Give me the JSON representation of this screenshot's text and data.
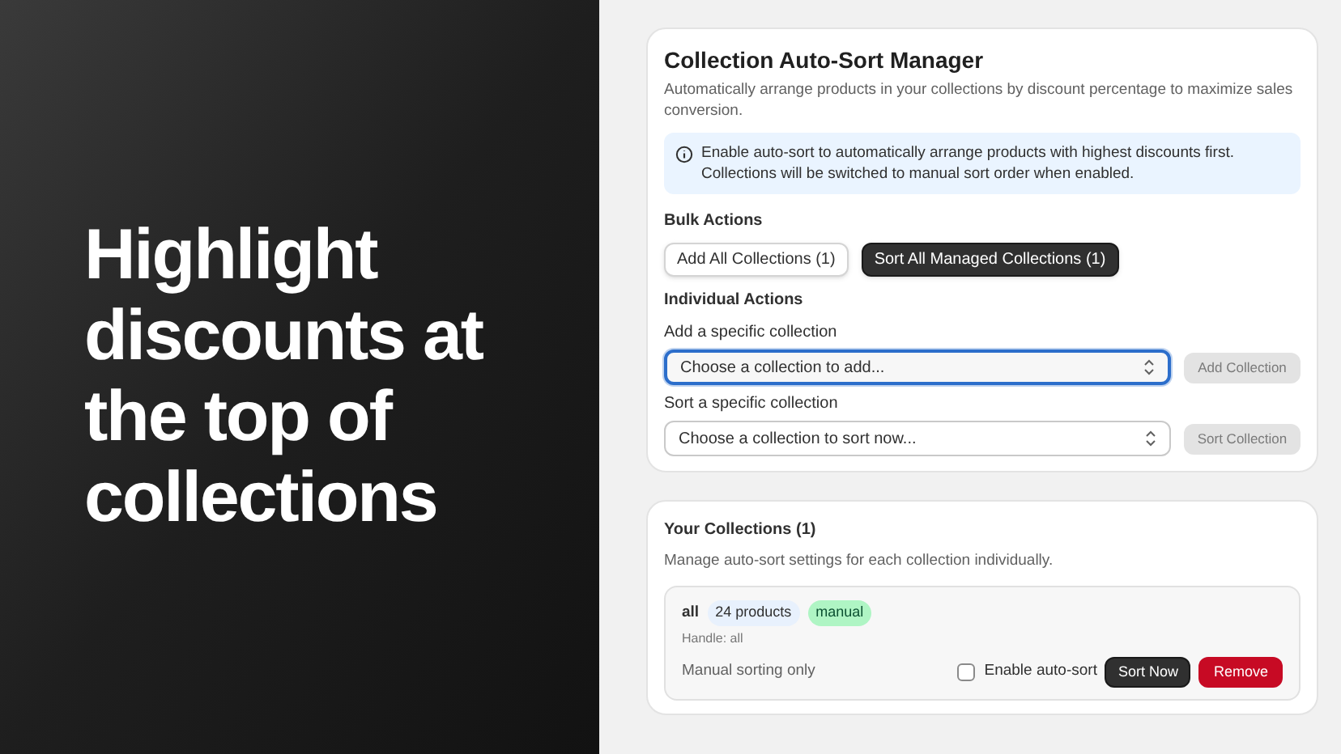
{
  "headline": "Highlight discounts at the top of collections",
  "manager": {
    "title": "Collection Auto-Sort Manager",
    "description": "Automatically arrange products in your collections by discount percentage to maximize sales conversion.",
    "info": "Enable auto-sort to automatically arrange products with highest discounts first. Collections will be switched to manual sort order when enabled.",
    "bulk_heading": "Bulk Actions",
    "bulk_buttons": [
      {
        "label": "Add All Collections (1)",
        "kind": "secondary"
      },
      {
        "label": "Sort All Managed Collections (1)",
        "kind": "primary"
      }
    ],
    "individual_heading": "Individual Actions",
    "pickers": [
      {
        "label": "Add a specific collection",
        "placeholder": "Choose a collection to add...",
        "focused": true,
        "button": "Add Collection",
        "disabled": true
      },
      {
        "label": "Sort a specific collection",
        "placeholder": "Choose a collection to sort now...",
        "focused": false,
        "button": "Sort Collection",
        "disabled": true
      }
    ]
  },
  "collections": {
    "title": "Your Collections (1)",
    "description": "Manage auto-sort settings for each collection individually.",
    "items": [
      {
        "name": "all",
        "count": "24 products",
        "sort_tag": "manual",
        "handle": "Handle: all",
        "status": "Manual sorting only",
        "auto_sort_label": "Enable auto-sort",
        "checked": false,
        "sort_button": "Sort Now",
        "remove_button": "Remove"
      }
    ]
  }
}
